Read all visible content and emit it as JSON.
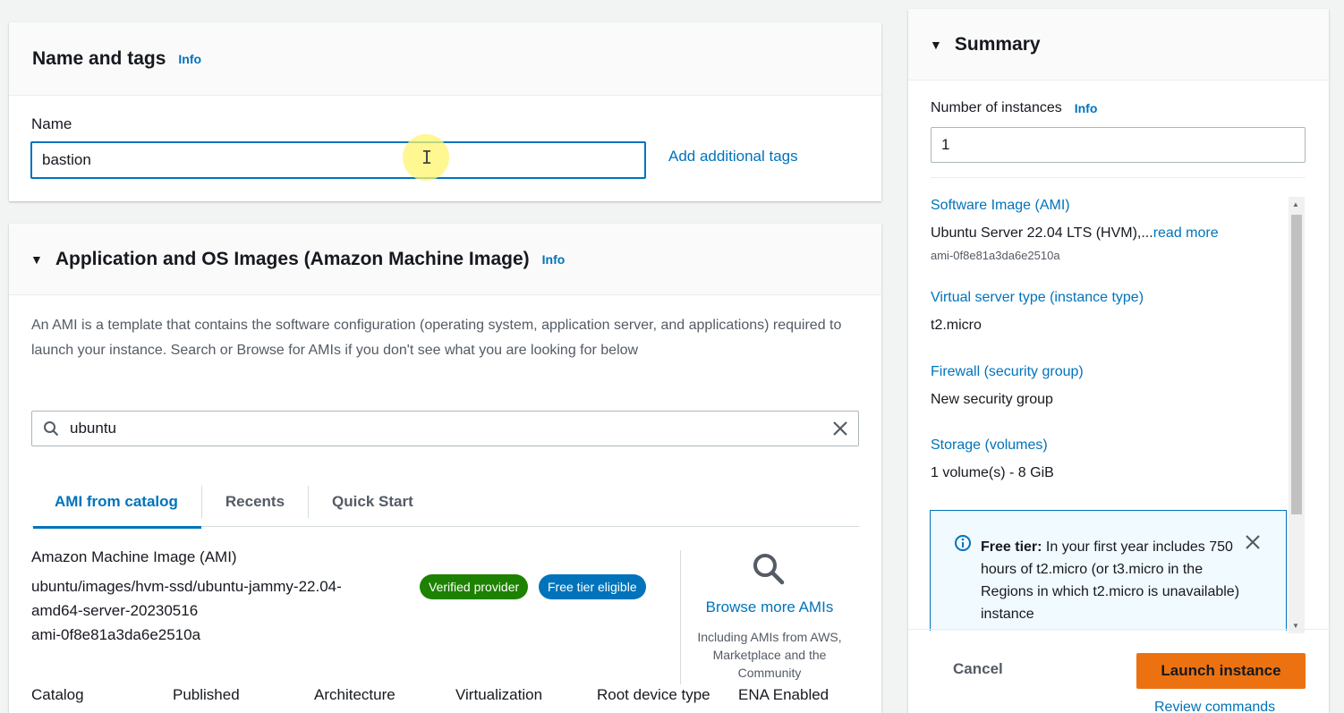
{
  "name_tags": {
    "title": "Name and tags",
    "info": "Info",
    "name_label": "Name",
    "name_value": "bastion",
    "add_tags": "Add additional tags"
  },
  "ami_section": {
    "title": "Application and OS Images (Amazon Machine Image)",
    "info": "Info",
    "description": "An AMI is a template that contains the software configuration (operating system, application server, and applications) required to launch your instance. Search or Browse for AMIs if you don't see what you are looking for below",
    "search_value": "ubuntu",
    "tabs": [
      "AMI from catalog",
      "Recents",
      "Quick Start"
    ],
    "card_title": "Amazon Machine Image (AMI)",
    "ami_path_1": "ubuntu/images/hvm-ssd/ubuntu-jammy-22.04-",
    "ami_path_2": "amd64-server-20230516",
    "ami_id": "ami-0f8e81a3da6e2510a",
    "badge_verified": "Verified provider",
    "badge_free": "Free tier eligible",
    "browse_link": "Browse more AMIs",
    "browse_sub": "Including AMIs from AWS, Marketplace and the Community",
    "columns": [
      "Catalog",
      "Published",
      "Architecture",
      "Virtualization",
      "Root device type",
      "ENA Enabled"
    ]
  },
  "summary": {
    "title": "Summary",
    "instances_label": "Number of instances",
    "info": "Info",
    "instances_value": "1",
    "software_image_key": "Software Image (AMI)",
    "software_image_val": "Ubuntu Server 22.04 LTS (HVM),...",
    "read_more": "read more",
    "ami_id": "ami-0f8e81a3da6e2510a",
    "instance_type_key": "Virtual server type (instance type)",
    "instance_type_val": "t2.micro",
    "firewall_key": "Firewall (security group)",
    "firewall_val": "New security group",
    "storage_key": "Storage (volumes)",
    "storage_val": "1 volume(s) - 8 GiB",
    "free_tier_bold": "Free tier:",
    "free_tier_text": " In your first year includes 750 hours of t2.micro (or t3.micro in the Regions in which t2.micro is unavailable) instance",
    "cancel": "Cancel",
    "launch": "Launch instance",
    "review": "Review commands"
  },
  "colors": {
    "link": "#0073bb",
    "launch": "#ec7211",
    "verified": "#1d8102"
  }
}
